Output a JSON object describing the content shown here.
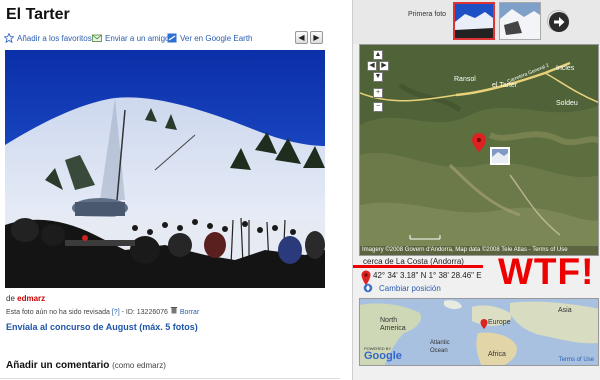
{
  "page": {
    "title": "El Tarter"
  },
  "actions": {
    "favorites": "Añadir a los favoritos",
    "send_friend": "Enviar a un amigo",
    "google_earth": "Ver en Google Earth",
    "prev": "◀",
    "next": "▶"
  },
  "photo_meta": {
    "by_prefix": "de",
    "author": "edmarz",
    "status": "Esta foto aún no ha sido revisada",
    "help": "[?]",
    "id_text": "- ID: 13226076",
    "delete": "Borrar",
    "contest": "Envíala al concurso de August (máx. 5 fotos)"
  },
  "comment": {
    "heading": "Añadir un comentario",
    "user": "(como edmarz)"
  },
  "sidebar": {
    "first_photo": "Primera foto",
    "map": {
      "labels": {
        "ransol": "Ransol",
        "el_tarter": "el Tarter",
        "incles": "Incles",
        "soldeu": "Soldeu",
        "road": "Carretera General 2"
      },
      "copyright": "Imagery ©2008 Govern d'Andorra, Map data ©2008 Tele Atlas - Terms of Use"
    },
    "near": "cerca de La Costa (Andorra)",
    "coords": "42° 34' 3.18\" N 1° 38' 28.46\" E",
    "change_position": "Cambiar posición",
    "annotation": "WTF!",
    "world": {
      "north_america": "North\nAmerica",
      "europe": "Europe",
      "asia": "Asia",
      "atlantic": "Atlantic\nOcean",
      "africa": "Africa",
      "powered": "POWERED BY",
      "google": "Google",
      "terms": "Terms of Use"
    }
  },
  "colors": {
    "link": "#2a5db0",
    "accent_red": "#e00000",
    "author": "#c00000"
  }
}
